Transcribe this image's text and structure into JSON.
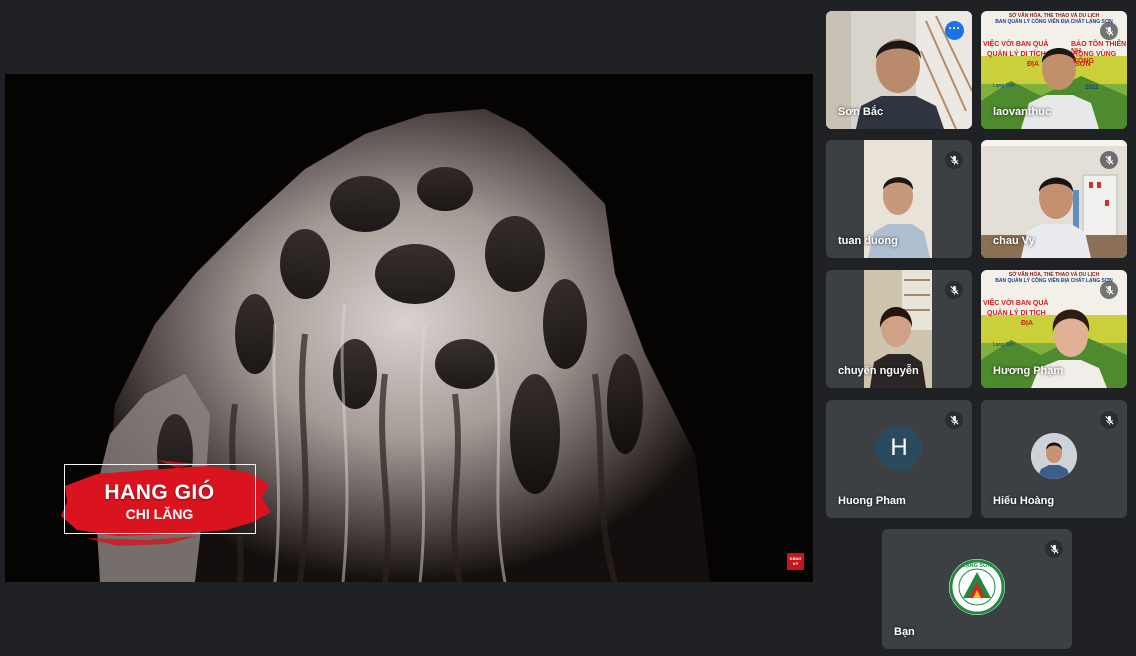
{
  "presentation": {
    "title_main": "HANG GIÓ",
    "title_sub": "CHI LĂNG",
    "corner_badge": "ĐĂNG KÝ"
  },
  "participants": [
    {
      "name": "Sơn Bắc",
      "state": "active-speaker",
      "control": "more-options"
    },
    {
      "name": "laovanthuc",
      "state": "muted"
    },
    {
      "name": "tuan duong",
      "state": "muted"
    },
    {
      "name": "chau Vy",
      "state": "muted"
    },
    {
      "name": "chuyên nguyễn",
      "state": "muted"
    },
    {
      "name": "Hương Phạm",
      "state": "muted"
    },
    {
      "name": "Huong Pham",
      "state": "muted",
      "avatar_letter": "H"
    },
    {
      "name": "Hiếu Hoàng",
      "state": "muted"
    },
    {
      "name": "Bạn",
      "state": "muted",
      "self": true
    }
  ],
  "slide_text": {
    "header": "SỞ VĂN HÓA, THỂ THAO VÀ DU LỊCH",
    "org": "BAN QUẢN LÝ CÔNG VIÊN ĐỊA CHẤT LẠNG SƠN",
    "line1": "VIỆC VỚI BAN QUẢ",
    "line1b": "BẢO TỒN THIÊN NH",
    "line2": "QUẢN LÝ DI TÍCH",
    "line2b": "RONG VÙNG CÔNG",
    "line3": "ĐỊA",
    "line3b": "SƠN",
    "place": "Lạng Sơn",
    "year": "2022"
  },
  "logo_text": "LẠNG SƠN",
  "colors": {
    "background": "#202124",
    "tile": "#3c4043",
    "active_outline": "#8ab4f8",
    "more_button": "#1a73e8",
    "title_red": "#d9141f"
  }
}
